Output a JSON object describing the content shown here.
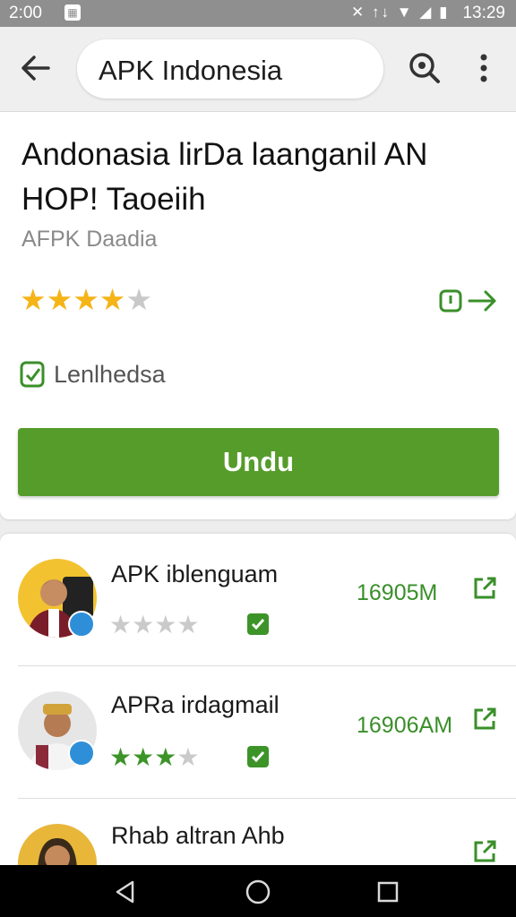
{
  "status_bar": {
    "time_left": "2:00",
    "time_right": "13:29",
    "icons": [
      "notification-icon",
      "mute-icon",
      "data-4g-icon",
      "wifi-icon",
      "signal-icon",
      "battery-icon"
    ]
  },
  "app_bar": {
    "search_query": "APK Indonesia",
    "icons": [
      "back-arrow-icon",
      "search-icon",
      "more-vert-icon"
    ]
  },
  "app": {
    "title": "Andonasia lirDa laanganil AN HOP! Taoeiih",
    "developer": "AFPK Daadia",
    "rating": 4,
    "rating_max": 5,
    "verified_label": "Lenlhedsa",
    "install_label": "Undu",
    "colors": {
      "accent": "#559c2a",
      "star": "#f5b417",
      "link": "#3a8f2a"
    }
  },
  "related": [
    {
      "title": "APK iblenguam",
      "rating": 4,
      "rating_max": 4,
      "star_color": "grey",
      "size": "16905M"
    },
    {
      "title": "APRa irdagmail",
      "rating": 3,
      "rating_max": 4,
      "star_color": "green",
      "size": "16906AM"
    },
    {
      "title": "Rhab altran Ahb",
      "rating": null,
      "size": ""
    }
  ],
  "nav_bar": {
    "icons": [
      "nav-back-icon",
      "nav-home-icon",
      "nav-recents-icon"
    ]
  }
}
